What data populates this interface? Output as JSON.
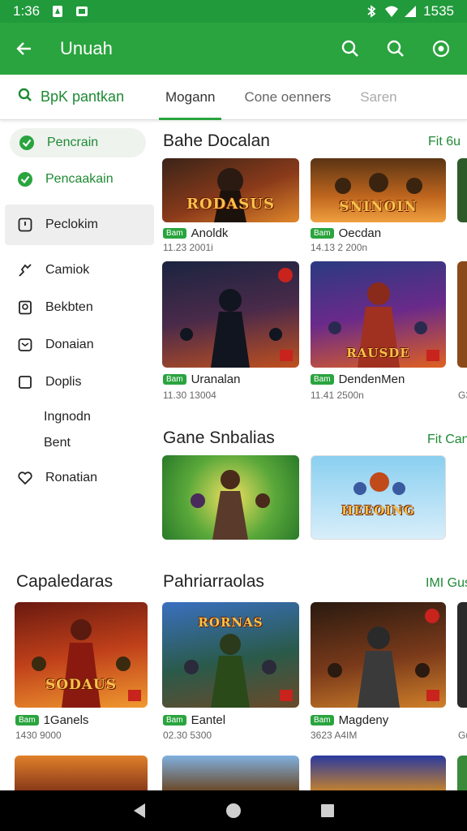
{
  "status": {
    "time": "1:36",
    "battery": "1535"
  },
  "app_bar": {
    "title": "Unuah"
  },
  "tabs": [
    {
      "label": "BpK pantkan"
    },
    {
      "label": "Mogann"
    },
    {
      "label": "Cone oenners"
    },
    {
      "label": "Saren"
    }
  ],
  "sidebar": {
    "items": [
      {
        "label": "Pencrain",
        "icon": "check-circle-icon"
      },
      {
        "label": "Pencaakain",
        "icon": "check-circle-icon"
      },
      {
        "label": "Peclokim",
        "icon": "info-square-icon"
      },
      {
        "label": "Camiok",
        "icon": "puzzle-icon"
      },
      {
        "label": "Bekbten",
        "icon": "badge-icon"
      },
      {
        "label": "Donaian",
        "icon": "inbox-icon"
      },
      {
        "label": "Doplis",
        "icon": "square-icon"
      },
      {
        "label": "Ingnodn",
        "icon": ""
      },
      {
        "label": "Bent",
        "icon": ""
      },
      {
        "label": "Ronatian",
        "icon": "heart-icon"
      }
    ]
  },
  "sections": {
    "s1": {
      "title": "Bahe Docalan",
      "more": "Fit 6u",
      "cards": [
        {
          "art": "RODASUS",
          "name": "Anoldk",
          "badge": "Bam",
          "sub": "11.23  2001i"
        },
        {
          "art": "SNINOIN",
          "name": "Oecdan",
          "badge": "Bam",
          "sub": "14.13  2 200n"
        },
        {
          "art": "",
          "name": "Uranalan",
          "badge": "Bam",
          "sub": "11.30  13004"
        },
        {
          "art": "RAUSDE",
          "name": "DendenMen",
          "badge": "Bam",
          "sub": "11.41  2500n"
        }
      ]
    },
    "s2": {
      "title": "Gane Snbalias",
      "more": "Fit Can",
      "cards": [
        {
          "art": ""
        },
        {
          "art": "HEEOING"
        }
      ]
    },
    "s3": {
      "title": "Pahriarraolas",
      "more": "IMI Gus",
      "cards": [
        {
          "art": "SODAUS",
          "name": "1Ganels",
          "badge": "Bam",
          "sub": "1430  9000"
        },
        {
          "art": "RORNAS",
          "name": "Eantel",
          "badge": "Bam",
          "sub": "02.30  5300"
        },
        {
          "art": "",
          "name": "Magdeny",
          "badge": "Bam",
          "sub": "3623  A4IM"
        }
      ]
    },
    "left_title": "Capaledaras",
    "partial_sub": "Gu",
    "partial_sub2": "G3"
  },
  "colors": {
    "primary": "#2aa43e",
    "status": "#219a3b"
  }
}
